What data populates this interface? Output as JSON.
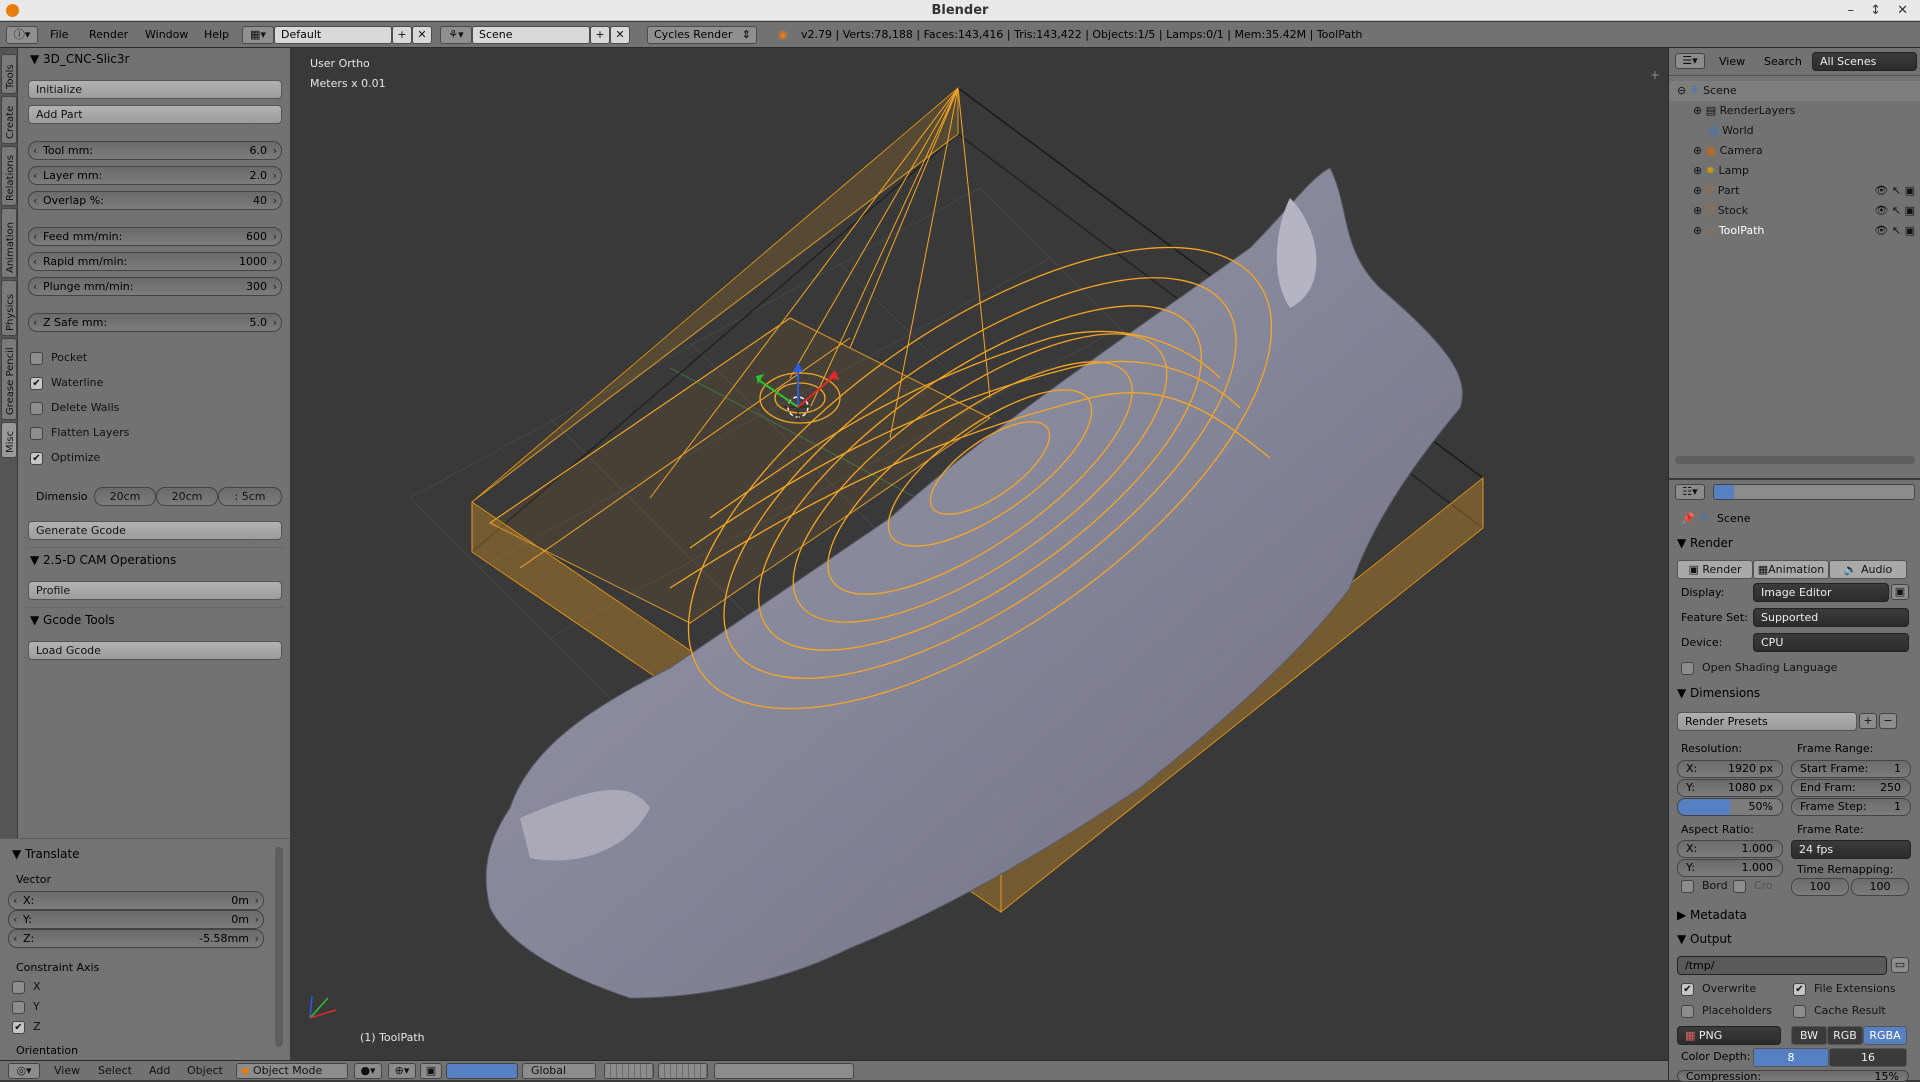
{
  "window": {
    "title": "Blender",
    "controls": "– ↕ ✕"
  },
  "topbar": {
    "menus": [
      "File",
      "Render",
      "Window",
      "Help"
    ],
    "layout": "Default",
    "scene": "Scene",
    "engine": "Cycles Render",
    "stats": "v2.79 | Verts:78,188 | Faces:143,416 | Tris:143,422 | Objects:1/5 | Lamps:0/1 | Mem:35.42M | ToolPath"
  },
  "left_tabs": [
    "Tools",
    "Create",
    "Relations",
    "Animation",
    "Physics",
    "Grease Pencil",
    "Misc"
  ],
  "cnc": {
    "title": "3D_CNC-Slic3r",
    "initialize": "Initialize",
    "add_part": "Add Part",
    "tool": {
      "label": "Tool mm:",
      "value": "6.0"
    },
    "layer": {
      "label": "Layer mm:",
      "value": "2.0"
    },
    "overlap": {
      "label": "Overlap %:",
      "value": "40"
    },
    "feed": {
      "label": "Feed mm/min:",
      "value": "600"
    },
    "rapid": {
      "label": "Rapid mm/min:",
      "value": "1000"
    },
    "plunge": {
      "label": "Plunge mm/min:",
      "value": "300"
    },
    "zsafe": {
      "label": "Z Safe mm:",
      "value": "5.0"
    },
    "checks": [
      {
        "label": "Pocket",
        "checked": false
      },
      {
        "label": "Waterline",
        "checked": true
      },
      {
        "label": "Delete Walls",
        "checked": false
      },
      {
        "label": "Flatten Layers",
        "checked": false
      },
      {
        "label": "Optimize",
        "checked": true
      }
    ],
    "dim_label": "Dimensio",
    "dims": [
      "20cm",
      "20cm",
      ": 5cm"
    ],
    "generate": "Generate Gcode",
    "cam_title": "2.5-D CAM Operations",
    "profile": "Profile",
    "gcode_title": "Gcode Tools",
    "load_gcode": "Load Gcode"
  },
  "translate": {
    "title": "Translate",
    "vector_label": "Vector",
    "x": {
      "label": "X:",
      "value": "0m"
    },
    "y": {
      "label": "Y:",
      "value": "0m"
    },
    "z": {
      "label": "Z:",
      "value": "-5.58mm"
    },
    "constraint_label": "Constraint Axis",
    "axes": [
      {
        "label": "X",
        "checked": false
      },
      {
        "label": "Y",
        "checked": false
      },
      {
        "label": "Z",
        "checked": true
      }
    ],
    "orientation_label": "Orientation"
  },
  "viewport": {
    "view_name": "User Ortho",
    "units": "Meters x 0.01",
    "object_label": "(1) ToolPath"
  },
  "bottombar": {
    "menus": [
      "View",
      "Select",
      "Add",
      "Object"
    ],
    "mode": "Object Mode",
    "orientation": "Global"
  },
  "outliner": {
    "menus": [
      "View",
      "Search"
    ],
    "filter": "All Scenes",
    "items": [
      {
        "label": "Scene",
        "indent": 0,
        "icon": "scene-icon"
      },
      {
        "label": "RenderLayers",
        "indent": 1,
        "icon": "render-layers-icon"
      },
      {
        "label": "World",
        "indent": 1,
        "icon": "world-icon"
      },
      {
        "label": "Camera",
        "indent": 1,
        "icon": "camera-icon"
      },
      {
        "label": "Lamp",
        "indent": 1,
        "icon": "lamp-icon"
      },
      {
        "label": "Part",
        "indent": 1,
        "icon": "mesh-icon"
      },
      {
        "label": "Stock",
        "indent": 1,
        "icon": "mesh-icon"
      },
      {
        "label": "ToolPath",
        "indent": 1,
        "icon": "curve-icon"
      }
    ]
  },
  "props": {
    "scene_label": "Scene",
    "render_title": "Render",
    "render_btns": [
      "Render",
      "Animation",
      "Audio"
    ],
    "display": {
      "label": "Display:",
      "value": "Image Editor"
    },
    "feature_set": {
      "label": "Feature Set:",
      "value": "Supported"
    },
    "device": {
      "label": "Device:",
      "value": "CPU"
    },
    "osl": "Open Shading Language",
    "dimensions_title": "Dimensions",
    "render_presets": "Render Presets",
    "resolution_label": "Resolution:",
    "res_x": {
      "label": "X:",
      "value": "1920 px"
    },
    "res_y": {
      "label": "Y:",
      "value": "1080 px"
    },
    "res_pct": "50%",
    "frame_range_label": "Frame Range:",
    "start": {
      "label": "Start Frame:",
      "value": "1"
    },
    "end": {
      "label": "End Fram:",
      "value": "250"
    },
    "step": {
      "label": "Frame Step:",
      "value": "1"
    },
    "aspect_label": "Aspect Ratio:",
    "asp_x": {
      "label": "X:",
      "value": "1.000"
    },
    "asp_y": {
      "label": "Y:",
      "value": "1.000"
    },
    "frame_rate_label": "Frame Rate:",
    "fps": "24 fps",
    "time_remap_label": "Time Remapping:",
    "remap_old": "100",
    "remap_new": "100",
    "bord": "Bord",
    "cro": "Cro",
    "metadata_title": "Metadata",
    "output_title": "Output",
    "path": "/tmp/",
    "overwrite": "Overwrite",
    "file_ext": "File Extensions",
    "placeholders": "Placeholders",
    "cache": "Cache Result",
    "format": "PNG",
    "color_modes": [
      "BW",
      "RGB",
      "RGBA"
    ],
    "color_depth_label": "Color Depth:",
    "depths": [
      "8",
      "16"
    ],
    "compression_label": "Compression:",
    "compression_value": "15%"
  },
  "colors": {
    "toolpath": "#f5a623",
    "mesh": "#8a8a98",
    "accent": "#5680c2"
  }
}
